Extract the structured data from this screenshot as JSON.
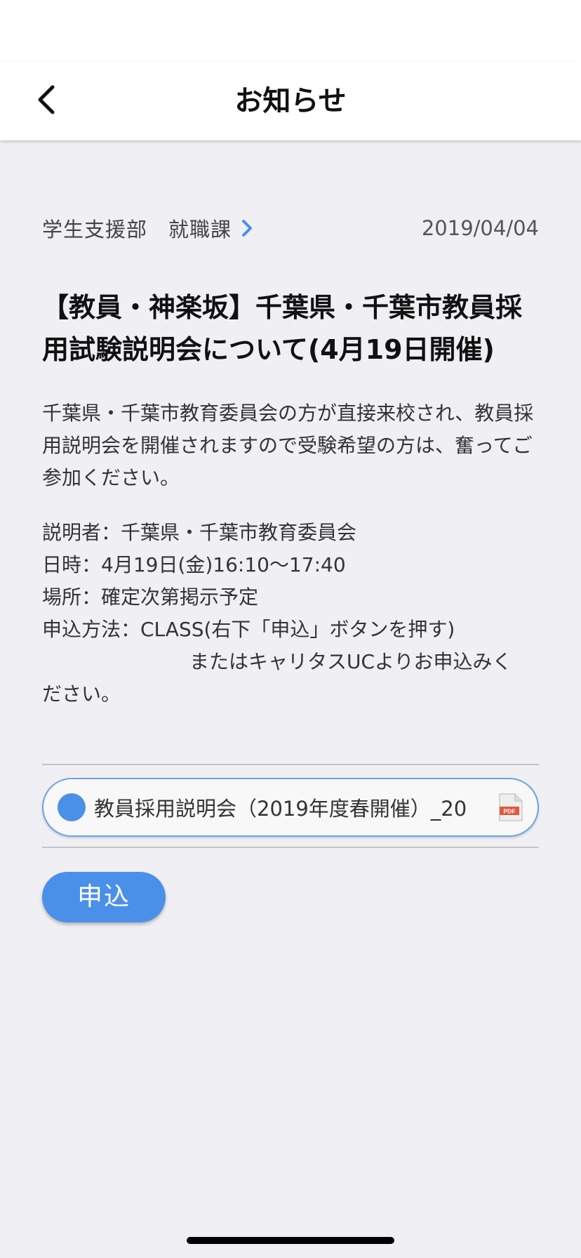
{
  "header": {
    "title": "お知らせ",
    "back_icon": "chevron-left-icon"
  },
  "notice": {
    "sender": "学生支援部　就職課",
    "sender_icon": "chevron-right-icon",
    "date": "2019/04/04",
    "title": "【教員・神楽坂】千葉県・千葉市教員採用試験説明会について(4月19日開催)",
    "body": "千葉県・千葉市教育委員会の方が直接来校され、教員採用説明会を開催されますので受験希望の方は、奮ってご参加ください。",
    "details": {
      "presenter": "説明者：千葉県・千葉市教育委員会",
      "datetime": "日時：4月19日(金)16:10〜17:40",
      "place": "場所：確定次第掲示予定",
      "method": "申込方法：CLASS(右下「申込」ボタンを押す)",
      "method_cont": "またはキャリタスUCよりお申込みく",
      "method_end": "ださい。"
    }
  },
  "attachment": {
    "name": "教員採用説明会（2019年度春開催）_20",
    "file_type": "PDF",
    "icon": "pdf-file-icon",
    "dot_color": "#4a90e8"
  },
  "actions": {
    "apply_label": "申込"
  },
  "colors": {
    "accent": "#4a90e8",
    "background": "#f0eff4",
    "header_bg": "#ffffff"
  }
}
